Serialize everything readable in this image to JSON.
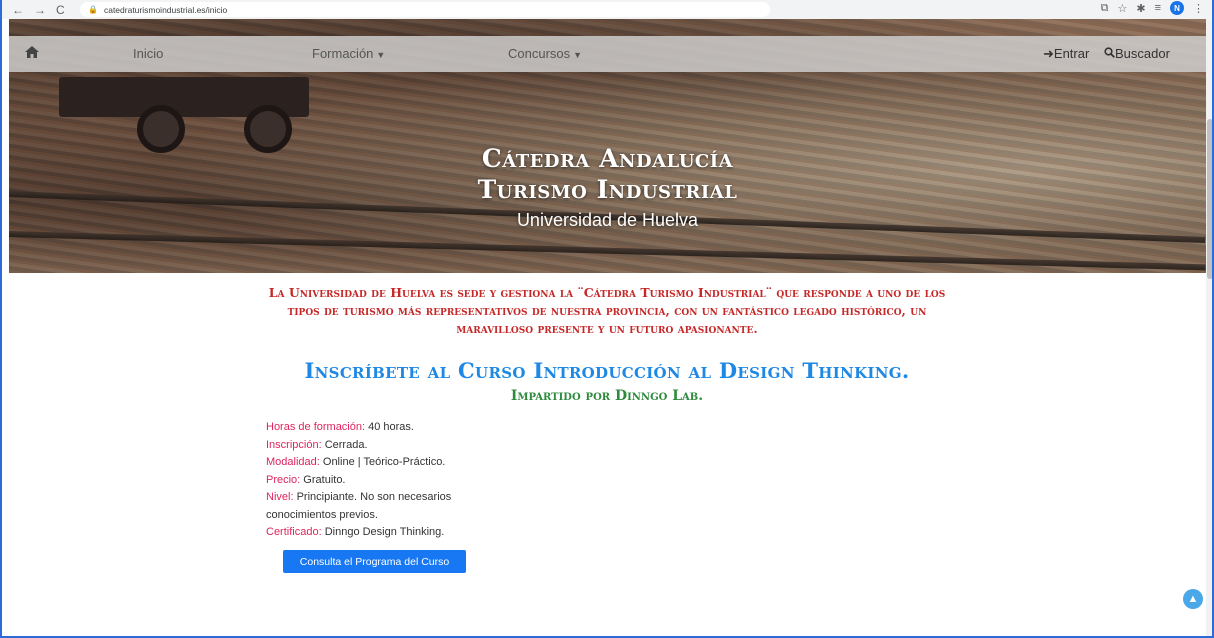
{
  "browser": {
    "url": "catedraturismoindustrial.es/inicio",
    "avatar_initial": "N",
    "icons": [
      "back-icon",
      "forward-icon",
      "reload-icon",
      "lock-icon",
      "share-icon",
      "star-icon",
      "extensions-icon",
      "reading-list-icon",
      "menu-icon"
    ]
  },
  "nav": {
    "home_icon": "home-icon",
    "inicio": "Inicio",
    "formacion": "Formación",
    "concursos": "Concursos",
    "entrar": "Entrar",
    "buscador": "Buscador"
  },
  "hero": {
    "title_line1": "Cátedra Andalucía",
    "title_line2": "Turismo Industrial",
    "subtitle": "Universidad de Huelva"
  },
  "intro": {
    "text": "La Universidad de Huelva es sede y gestiona la ¨Cátedra Turismo Industrial¨ que responde a uno de los tipos de turismo más representativos de nuestra provincia, con un fantástico legado histórico, un maravilloso presente y un futuro apasionante."
  },
  "course": {
    "title": "Inscríbete al Curso Introducción al Design Thinking.",
    "subtitle": "Impartido por Dinngo Lab.",
    "details": [
      {
        "label": "Horas de formación:",
        "value": " 40 horas."
      },
      {
        "label": "Inscripción:",
        "value": " Cerrada."
      },
      {
        "label": "Modalidad:",
        "value": " Online | Teórico-Práctico."
      },
      {
        "label": "Precio:",
        "value": " Gratuito."
      },
      {
        "label": "Nivel:",
        "value": " Principiante. No son necesarios conocimientos previos."
      },
      {
        "label": "Certificado:",
        "value": " Dinngo Design Thinking."
      }
    ],
    "button_label": "Consulta el Programa del Curso"
  },
  "colors": {
    "intro_red": "#c62828",
    "title_blue": "#1e88e5",
    "subtitle_green": "#2e8b3e",
    "label_pink": "#e0245e",
    "button_blue": "#1877f2"
  }
}
